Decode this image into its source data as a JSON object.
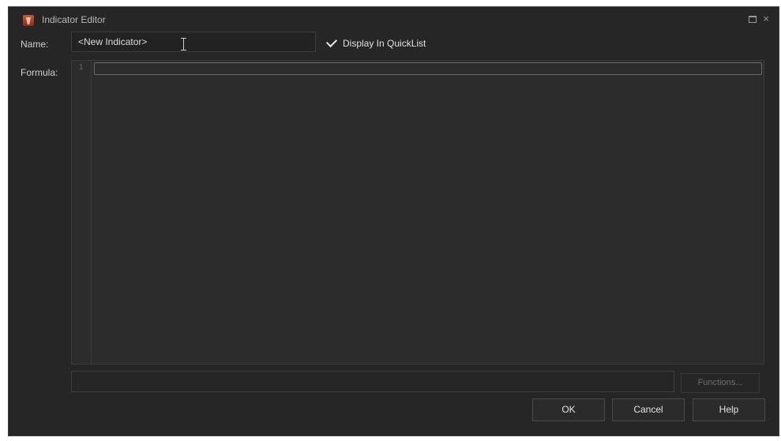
{
  "window": {
    "title": "Indicator Editor",
    "close_glyph": "×"
  },
  "form": {
    "name_label": "Name:",
    "name_value": "<New Indicator>",
    "quicklist_label": "Display In QuickList",
    "quicklist_checked": true,
    "formula_label": "Formula:"
  },
  "editor": {
    "line_numbers": [
      "1"
    ],
    "content": ""
  },
  "buttons": {
    "functions": "Functions...",
    "ok": "OK",
    "cancel": "Cancel",
    "help": "Help"
  },
  "icons": {
    "app": "indicator-editor-app-icon",
    "maximize": "maximize-icon",
    "close": "close-icon",
    "check": "checkmark-icon",
    "cursor": "text-cursor-icon"
  }
}
